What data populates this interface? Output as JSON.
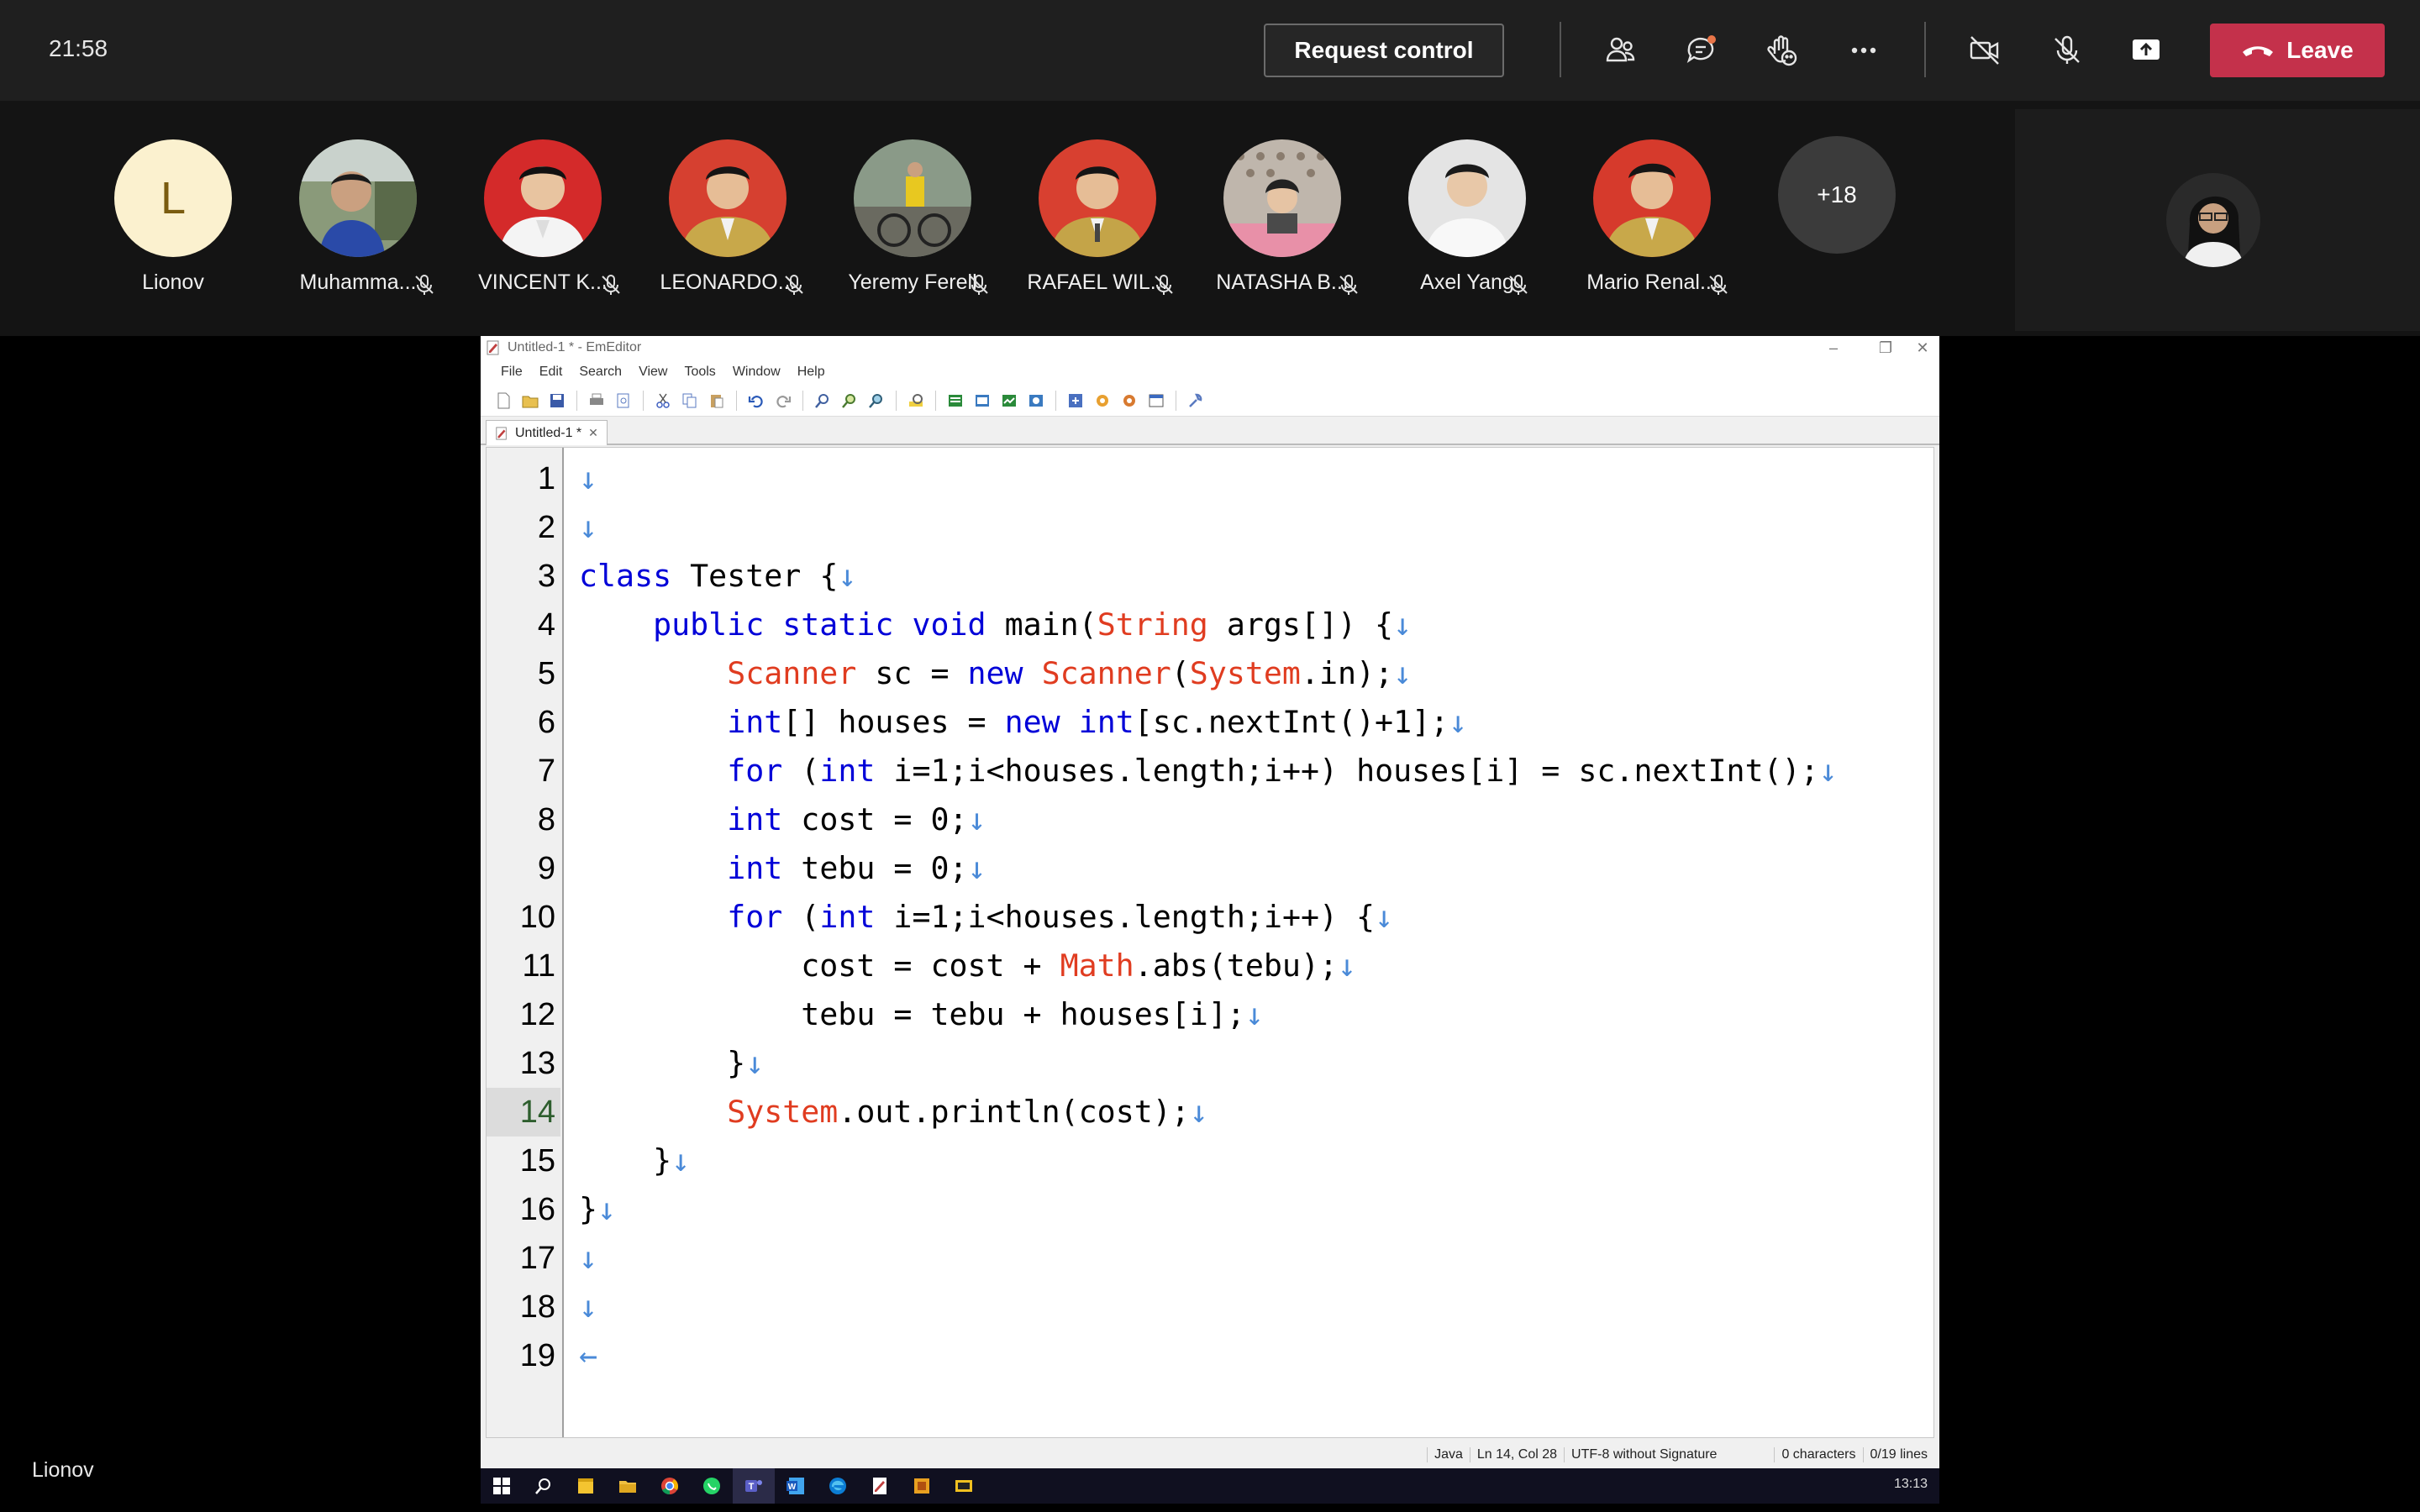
{
  "meeting": {
    "time": "21:58",
    "request_control_label": "Request control",
    "leave_label": "Leave",
    "colors": {
      "leave": "#c4314b",
      "bar": "#1f1f1f",
      "strip": "#141414"
    }
  },
  "participants": [
    {
      "name": "Lionov",
      "initial": "L",
      "muted": false
    },
    {
      "name": "Muhamma...",
      "muted": true
    },
    {
      "name": "VINCENT K...",
      "muted": true
    },
    {
      "name": "LEONARDO...",
      "muted": true
    },
    {
      "name": "Yeremy Ferell",
      "muted": true
    },
    {
      "name": "RAFAEL WIL...",
      "muted": true
    },
    {
      "name": "NATASHA B...",
      "muted": true
    },
    {
      "name": "Axel Yang",
      "muted": true
    },
    {
      "name": "Mario Renal...",
      "muted": true
    }
  ],
  "more_participants": "+18",
  "presenter_name": "Lionov",
  "editor": {
    "window_title": "Untitled-1 * - EmEditor",
    "menu": [
      "File",
      "Edit",
      "Search",
      "View",
      "Tools",
      "Window",
      "Help"
    ],
    "tab_label": "Untitled-1 *",
    "current_line": 14,
    "line_numbers": [
      "1",
      "2",
      "3",
      "4",
      "5",
      "6",
      "7",
      "8",
      "9",
      "10",
      "11",
      "12",
      "13",
      "14",
      "15",
      "16",
      "17",
      "18",
      "19"
    ],
    "lines": [
      "",
      "",
      "class Tester {",
      "    public static void main(String args[]) {",
      "        Scanner sc = new Scanner(System.in);",
      "        int[] houses = new int[sc.nextInt()+1];",
      "        for (int i=1;i<houses.length;i++) houses[i] = sc.nextInt();",
      "        int cost = 0;",
      "        int tebu = 0;",
      "        for (int i=1;i<houses.length;i++) {",
      "            cost = cost + Math.abs(tebu);",
      "            tebu = tebu + houses[i];",
      "        }",
      "        System.out.println(cost);",
      "    }",
      "}",
      "",
      "",
      ""
    ],
    "status": {
      "language": "Java",
      "position": "Ln 14, Col 28",
      "encoding": "UTF-8 without Signature",
      "chars": "0 characters",
      "lines": "0/19 lines"
    },
    "colors": {
      "keyword": "#0000d8",
      "type": "#e03c20",
      "newline": "#4a8ad8"
    }
  },
  "taskbar": {
    "clock": "13:13"
  }
}
